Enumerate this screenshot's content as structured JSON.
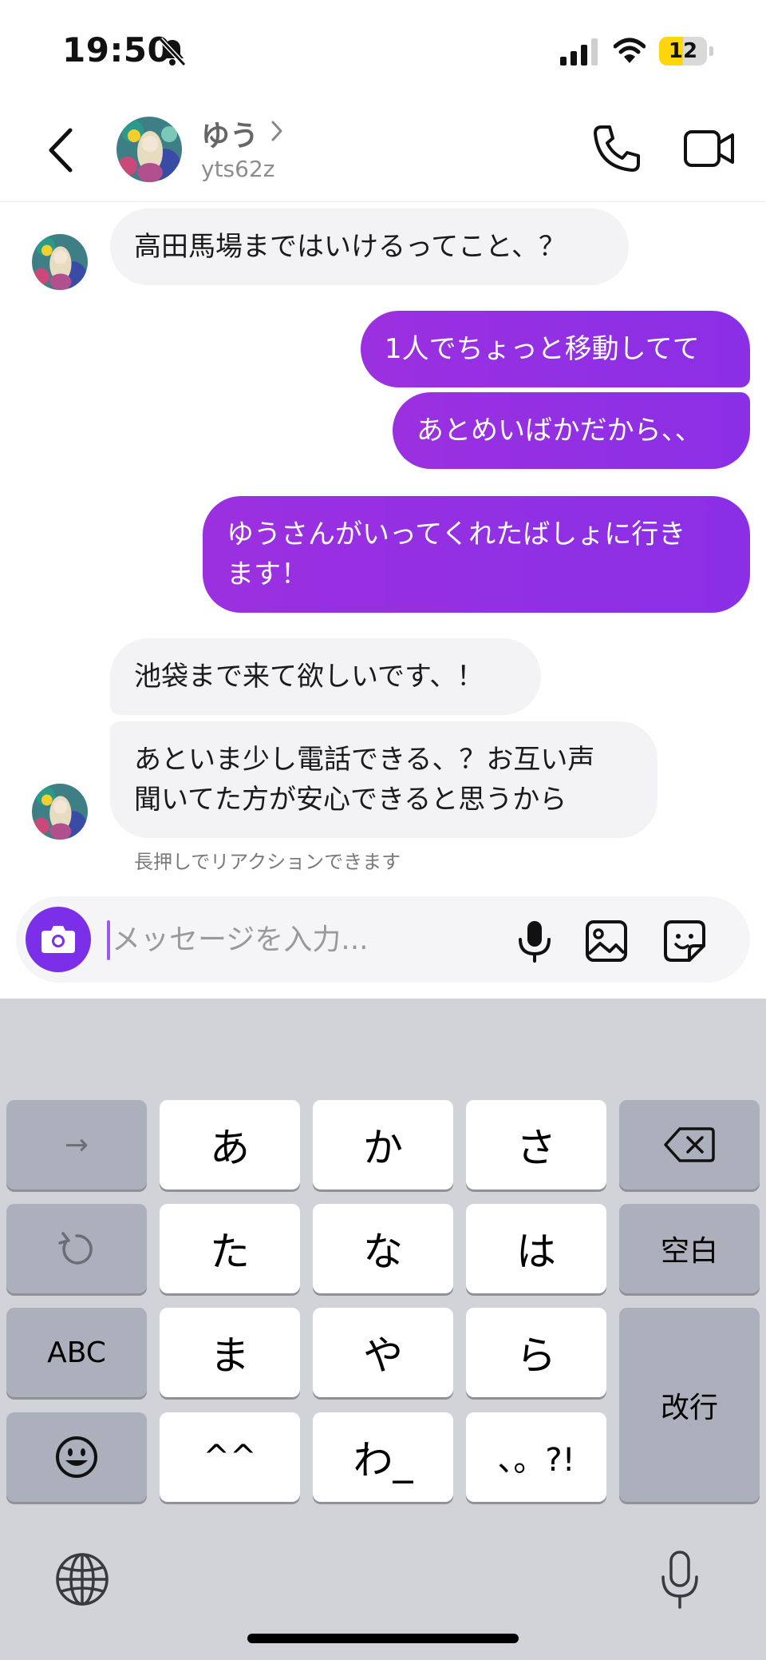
{
  "status_bar": {
    "time": "19:50",
    "battery": "12",
    "battery_level": 0.12,
    "icons": [
      "bell-off-icon",
      "signal-icon",
      "wifi-icon",
      "battery-icon"
    ]
  },
  "header": {
    "name": "ゆう",
    "handle": "yts62z",
    "icons": [
      "back-chevron-icon",
      "chevron-right-icon",
      "phone-icon",
      "video-camera-icon"
    ]
  },
  "messages": [
    {
      "side": "in",
      "text": "高田馬場まではいけるってこと、？"
    },
    {
      "side": "out",
      "text": "1人でちょっと移動してて"
    },
    {
      "side": "out",
      "text": "あとめいばかだから、、"
    },
    {
      "side": "out",
      "text_lines": [
        "ゆうさんがいってくれたばしょに行き",
        "ます！"
      ]
    },
    {
      "side": "in",
      "text": "池袋まで来て欲しいです、！"
    },
    {
      "side": "in",
      "text_lines": [
        "あといま少し電話できる、？お互い声",
        "聞いてた方が安心できると思うから"
      ]
    }
  ],
  "hint": "長押しでリアクションできます",
  "composer": {
    "placeholder": "メッセージを入力...",
    "value": "",
    "icons": [
      "camera-icon",
      "microphone-icon",
      "image-icon",
      "sticker-icon"
    ]
  },
  "keyboard": {
    "left_col": [
      "→",
      "undo-icon",
      "ABC",
      "emoji-icon"
    ],
    "kana": [
      [
        "あ",
        "か",
        "さ"
      ],
      [
        "た",
        "な",
        "は"
      ],
      [
        "ま",
        "や",
        "ら"
      ],
      [
        "^^",
        "わ_",
        "、。?!"
      ]
    ],
    "right_col": [
      "delete-icon",
      "空白",
      "改行"
    ],
    "bottom": [
      "globe-icon",
      "dictation-mic-icon"
    ]
  },
  "colors": {
    "accent": "#7b2fe9",
    "bubble_out": "#9330e3",
    "bubble_in": "#f3f3f6",
    "keyboard_bg": "#d1d3d9"
  }
}
